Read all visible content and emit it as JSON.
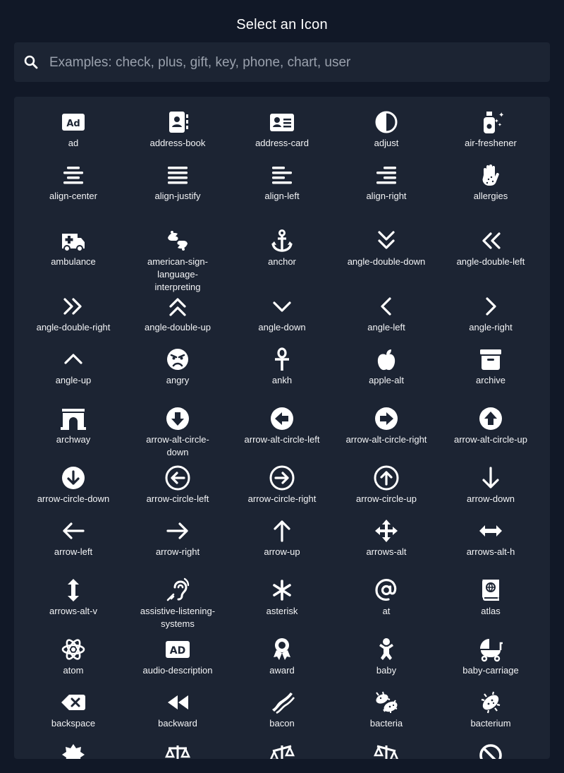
{
  "dialog": {
    "title": "Select an Icon",
    "search_placeholder": "Examples: check, plus, gift, key, phone, chart, user"
  },
  "colors": {
    "background": "#111827",
    "panel": "#1c2433",
    "text": "#ffffff",
    "placeholder": "#9aa1ad"
  },
  "rows": [
    [
      {
        "label": "ad",
        "icon": "ad-icon"
      },
      {
        "label": "address-book",
        "icon": "address-book-icon"
      },
      {
        "label": "address-card",
        "icon": "address-card-icon"
      },
      {
        "label": "adjust",
        "icon": "adjust-icon"
      },
      {
        "label": "air-freshener",
        "icon": "air-freshener-icon"
      }
    ],
    [
      {
        "label": "align-center",
        "icon": "align-center-icon"
      },
      {
        "label": "align-justify",
        "icon": "align-justify-icon"
      },
      {
        "label": "align-left",
        "icon": "align-left-icon"
      },
      {
        "label": "align-right",
        "icon": "align-right-icon"
      },
      {
        "label": "allergies",
        "icon": "allergies-icon"
      }
    ],
    [
      {
        "label": "ambulance",
        "icon": "ambulance-icon"
      },
      {
        "label": "american-sign-language-interpreting",
        "icon": "american-sign-language-interpreting-icon"
      },
      {
        "label": "anchor",
        "icon": "anchor-icon"
      },
      {
        "label": "angle-double-down",
        "icon": "angle-double-down-icon"
      },
      {
        "label": "angle-double-left",
        "icon": "angle-double-left-icon"
      }
    ],
    [
      {
        "label": "angle-double-right",
        "icon": "angle-double-right-icon"
      },
      {
        "label": "angle-double-up",
        "icon": "angle-double-up-icon"
      },
      {
        "label": "angle-down",
        "icon": "angle-down-icon"
      },
      {
        "label": "angle-left",
        "icon": "angle-left-icon"
      },
      {
        "label": "angle-right",
        "icon": "angle-right-icon"
      }
    ],
    [
      {
        "label": "angle-up",
        "icon": "angle-up-icon"
      },
      {
        "label": "angry",
        "icon": "angry-icon"
      },
      {
        "label": "ankh",
        "icon": "ankh-icon"
      },
      {
        "label": "apple-alt",
        "icon": "apple-alt-icon"
      },
      {
        "label": "archive",
        "icon": "archive-icon"
      }
    ],
    [
      {
        "label": "archway",
        "icon": "archway-icon"
      },
      {
        "label": "arrow-alt-circle-down",
        "icon": "arrow-alt-circle-down-icon"
      },
      {
        "label": "arrow-alt-circle-left",
        "icon": "arrow-alt-circle-left-icon"
      },
      {
        "label": "arrow-alt-circle-right",
        "icon": "arrow-alt-circle-right-icon"
      },
      {
        "label": "arrow-alt-circle-up",
        "icon": "arrow-alt-circle-up-icon"
      }
    ],
    [
      {
        "label": "arrow-circle-down",
        "icon": "arrow-circle-down-icon"
      },
      {
        "label": "arrow-circle-left",
        "icon": "arrow-circle-left-icon"
      },
      {
        "label": "arrow-circle-right",
        "icon": "arrow-circle-right-icon"
      },
      {
        "label": "arrow-circle-up",
        "icon": "arrow-circle-up-icon"
      },
      {
        "label": "arrow-down",
        "icon": "arrow-down-icon"
      }
    ],
    [
      {
        "label": "arrow-left",
        "icon": "arrow-left-icon"
      },
      {
        "label": "arrow-right",
        "icon": "arrow-right-icon"
      },
      {
        "label": "arrow-up",
        "icon": "arrow-up-icon"
      },
      {
        "label": "arrows-alt",
        "icon": "arrows-alt-icon"
      },
      {
        "label": "arrows-alt-h",
        "icon": "arrows-alt-h-icon"
      }
    ],
    [
      {
        "label": "arrows-alt-v",
        "icon": "arrows-alt-v-icon"
      },
      {
        "label": "assistive-listening-systems",
        "icon": "assistive-listening-systems-icon"
      },
      {
        "label": "asterisk",
        "icon": "asterisk-icon"
      },
      {
        "label": "at",
        "icon": "at-icon"
      },
      {
        "label": "atlas",
        "icon": "atlas-icon"
      }
    ],
    [
      {
        "label": "atom",
        "icon": "atom-icon"
      },
      {
        "label": "audio-description",
        "icon": "audio-description-icon"
      },
      {
        "label": "award",
        "icon": "award-icon"
      },
      {
        "label": "baby",
        "icon": "baby-icon"
      },
      {
        "label": "baby-carriage",
        "icon": "baby-carriage-icon"
      }
    ],
    [
      {
        "label": "backspace",
        "icon": "backspace-icon"
      },
      {
        "label": "backward",
        "icon": "backward-icon"
      },
      {
        "label": "bacon",
        "icon": "bacon-icon"
      },
      {
        "label": "bacteria",
        "icon": "bacteria-icon"
      },
      {
        "label": "bacterium",
        "icon": "bacterium-icon"
      }
    ],
    [
      {
        "label": "",
        "icon": "badge-icon"
      },
      {
        "label": "",
        "icon": "balance-scale-icon"
      },
      {
        "label": "",
        "icon": "balance-scale-left-icon"
      },
      {
        "label": "",
        "icon": "balance-scale-right-icon"
      },
      {
        "label": "",
        "icon": "ban-icon"
      }
    ]
  ]
}
